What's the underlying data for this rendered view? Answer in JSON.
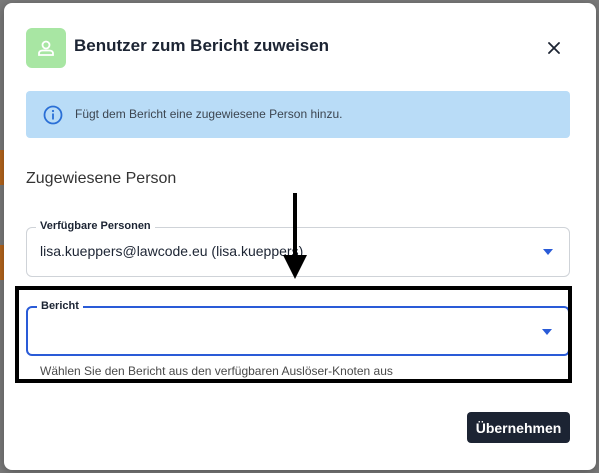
{
  "dialog": {
    "title": "Benutzer zum Bericht zuweisen",
    "close_label": "close",
    "info_text": "Fügt dem Bericht eine zugewiesene Person hinzu.",
    "section_label": "Zugewiesene Person"
  },
  "fields": {
    "available_persons": {
      "label": "Verfügbare Personen",
      "value": "lisa.kueppers@lawcode.eu (lisa.kueppers)"
    },
    "report": {
      "label": "Bericht",
      "value": "",
      "helper": "Wählen Sie den Bericht aus den verfügbaren Auslöser-Knoten aus"
    }
  },
  "actions": {
    "apply_label": "Übernehmen"
  },
  "icons": {
    "header": "user-icon",
    "info": "info-icon",
    "close": "close-icon",
    "dropdown": "chevron-down-icon"
  },
  "colors": {
    "accent": "#2a5bd7",
    "avatar_bg": "#a8e6a3",
    "info_bg": "#b9dcf7",
    "button_bg": "#1c2433"
  }
}
